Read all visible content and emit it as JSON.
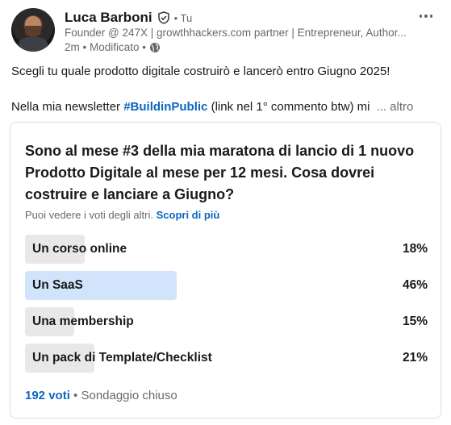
{
  "author": {
    "name": "Luca Barboni",
    "degree": "• Tu",
    "headline": "Founder @ 247X | growthhackers.com partner | Entrepreneur, Author...",
    "time": "2m • Modificato •"
  },
  "post": {
    "line1": "Scegli tu quale prodotto digitale costruirò e lancerò entro Giugno 2025!",
    "line2_prefix": "Nella mia newsletter ",
    "hashtag": "#BuildinPublic",
    "line2_suffix": " (link nel 1° commento btw) mi",
    "see_more": "... altro"
  },
  "poll": {
    "question": "Sono al mese #3 della mia maratona di lancio di 1 nuovo Prodotto Digitale al mese per 12 mesi. Cosa dovrei costruire e lanciare a Giugno?",
    "visibility_text": "Puoi vedere i voti degli altri.",
    "visibility_link": "Scopri di più",
    "options": [
      {
        "label": "Un corso online",
        "percent": 18,
        "percent_label": "18%",
        "selected": false
      },
      {
        "label": "Un SaaS",
        "percent": 46,
        "percent_label": "46%",
        "selected": true
      },
      {
        "label": "Una membership",
        "percent": 15,
        "percent_label": "15%",
        "selected": false
      },
      {
        "label": "Un pack di Template/Checklist",
        "percent": 21,
        "percent_label": "21%",
        "selected": false
      }
    ],
    "votes": "192 voti",
    "status": "• Sondaggio chiuso"
  },
  "colors": {
    "accent": "#0a66c2",
    "bar": "#e8e8e8",
    "bar_selected": "#d2e4fb"
  },
  "icons": {
    "verified": "verified-shield-icon",
    "visibility": "globe-icon",
    "menu": "more-dots-icon"
  }
}
